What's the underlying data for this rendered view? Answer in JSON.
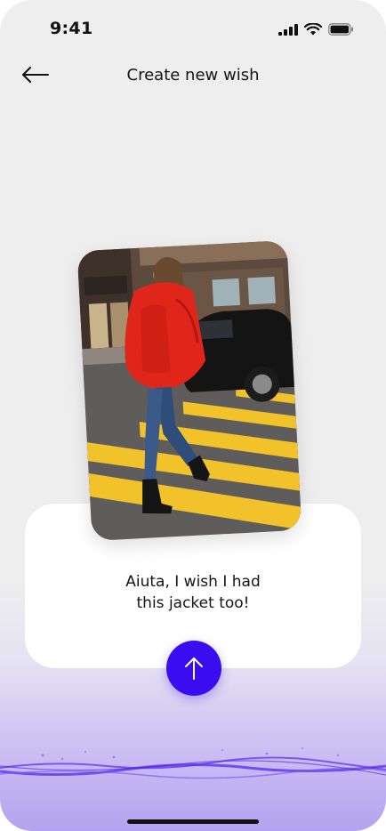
{
  "status_bar": {
    "time": "9:41",
    "icons": [
      "signal-icon",
      "wifi-icon",
      "battery-icon"
    ]
  },
  "header": {
    "back_icon": "arrow-left-icon",
    "title": "Create new wish"
  },
  "photo": {
    "description": "woman-in-red-jacket-street-photo"
  },
  "message": {
    "line1": "Aiuta, I wish I had",
    "line2": "this jacket too!"
  },
  "send_button": {
    "icon": "arrow-up-icon"
  },
  "colors": {
    "accent": "#3a0df0",
    "background": "#eeeeee",
    "card": "#ffffff",
    "wave": "#6f4df2"
  }
}
